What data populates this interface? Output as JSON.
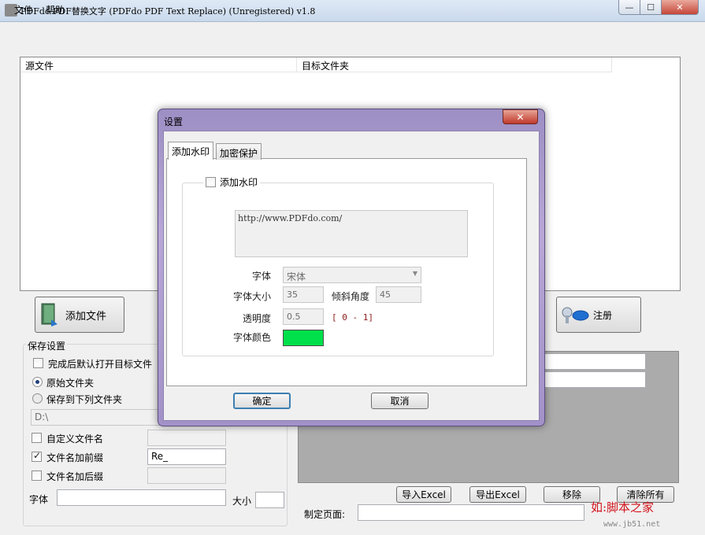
{
  "window": {
    "title": "PDFdo PDF替换文字 (PDFdo PDF Text Replace) (Unregistered) v1.8",
    "close_label": "✕",
    "min_label": "—",
    "max_label": "☐"
  },
  "menu": {
    "file": "文件",
    "help": "帮助"
  },
  "file_list": {
    "col_source": "源文件",
    "col_target": "目标文件夹"
  },
  "buttons": {
    "add_file": "添加文件",
    "register": "注册"
  },
  "save_settings": {
    "legend": "保存设置",
    "open_after": {
      "label": "完成后默认打开目标文件",
      "checked": false
    },
    "radio_original": {
      "label": "原始文件夹",
      "selected": true
    },
    "radio_custom": {
      "label": "保存到下列文件夹",
      "selected": false
    },
    "folder_path": "D:\\",
    "custom_name": {
      "label": "自定义文件名",
      "checked": false,
      "value": ""
    },
    "prefix": {
      "label": "文件名加前缀",
      "checked": true,
      "value": "Re_"
    },
    "suffix": {
      "label": "文件名加后缀",
      "checked": false,
      "value": ""
    },
    "font_label": "字体",
    "size_label": "大小"
  },
  "actions": {
    "import_excel": "导入Excel",
    "export_excel": "导出Excel",
    "remove": "移除",
    "clear_all": "清除所有",
    "page_label": "制定页面:"
  },
  "dialog": {
    "title": "设置",
    "close_label": "✕",
    "tabs": [
      "添加水印",
      "加密保护"
    ],
    "active_tab": "添加水印",
    "add_watermark": {
      "label": "添加水印",
      "checked": false
    },
    "watermark_text": "http://www.PDFdo.com/",
    "font": {
      "label": "字体",
      "value": "宋体"
    },
    "font_size": {
      "label": "字体大小",
      "value": "35"
    },
    "angle": {
      "label": "倾斜角度",
      "value": "45"
    },
    "opacity": {
      "label": "透明度",
      "value": "0.5",
      "range": "[ 0 - 1]"
    },
    "font_color": {
      "label": "字体颜色",
      "color": "#00e04a"
    },
    "ok": "确定",
    "cancel": "取消"
  },
  "overlay_watermark": {
    "site": "如:脚本之家",
    "url": "www.jb51.net"
  },
  "colors": {
    "dialog_frame": "#b3a3d6",
    "accent": "#3c7fb1"
  }
}
